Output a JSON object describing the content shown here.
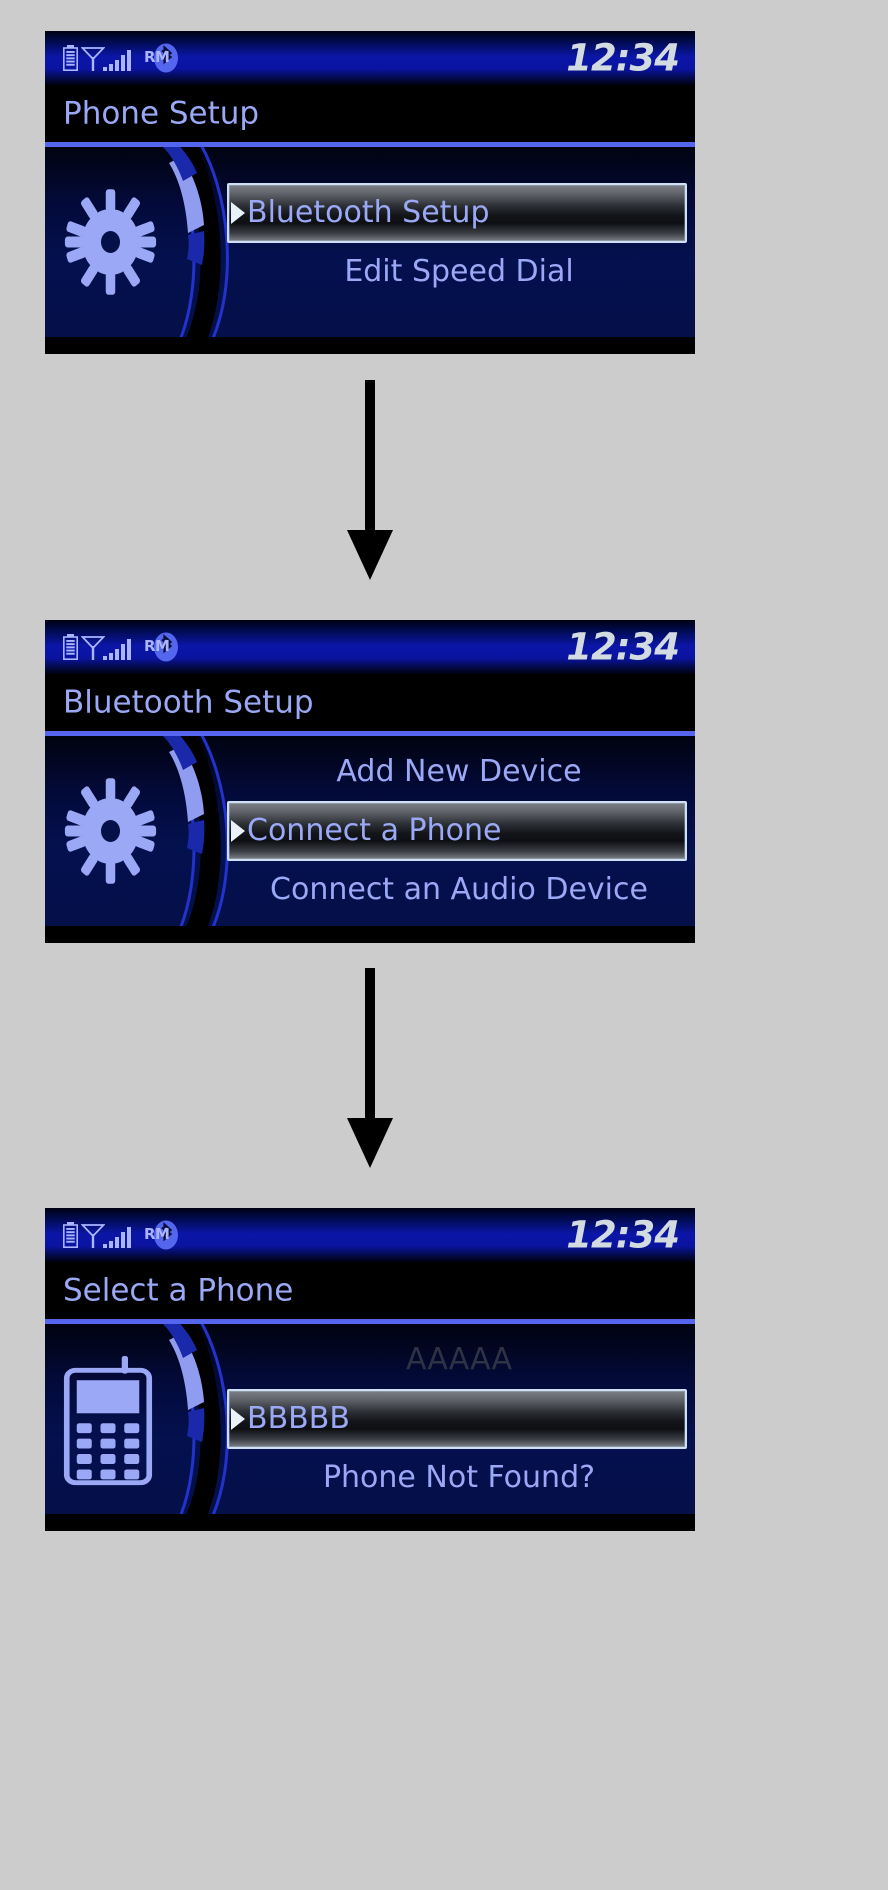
{
  "canvas": {
    "background": "#cccccc",
    "accent_blue": "#5566ee",
    "text_blue": "#9aa8f5",
    "dim_text": "#2d3344",
    "clock_color": "#d2dbe0"
  },
  "status_bar": {
    "roaming_label": "RM",
    "clock": "12:34",
    "icons": [
      {
        "name": "battery-icon",
        "label": "battery"
      },
      {
        "name": "antenna-icon",
        "label": "antenna"
      },
      {
        "name": "signal-bars-icon",
        "label": "signal-strength",
        "bars": 5
      },
      {
        "name": "bluetooth-icon",
        "label": "bluetooth"
      }
    ]
  },
  "screens": [
    {
      "id": "phone-setup",
      "title": "Phone Setup",
      "side_icon": "gear-icon",
      "items": [
        {
          "label": "Bluetooth Setup",
          "state": "selected"
        },
        {
          "label": "Edit Speed Dial",
          "state": "normal"
        }
      ]
    },
    {
      "id": "bluetooth-setup",
      "title": "Bluetooth Setup",
      "side_icon": "gear-icon",
      "items": [
        {
          "label": "Add New Device",
          "state": "normal"
        },
        {
          "label": "Connect a Phone",
          "state": "selected"
        },
        {
          "label": "Connect an Audio Device",
          "state": "normal"
        }
      ]
    },
    {
      "id": "select-a-phone",
      "title": "Select a Phone",
      "side_icon": "mobile-phone-icon",
      "items": [
        {
          "label": "AAAAA",
          "state": "dim"
        },
        {
          "label": "BBBBB",
          "state": "selected"
        },
        {
          "label": "Phone Not Found?",
          "state": "normal"
        }
      ]
    }
  ],
  "connectors": [
    {
      "name": "flow-arrow-1",
      "direction": "down"
    },
    {
      "name": "flow-arrow-2",
      "direction": "down"
    }
  ]
}
